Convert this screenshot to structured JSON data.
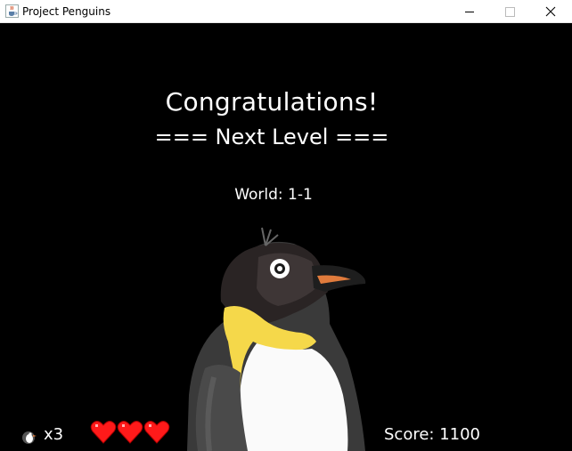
{
  "window": {
    "title": "Project Penguins",
    "icon": "java-cup-icon"
  },
  "game": {
    "message_line1": "Congratulations!",
    "message_line2": "=== Next Level ===",
    "world_label": "World: 1-1",
    "lives_text": "x3",
    "lives_count": 3,
    "hearts_shown": 3,
    "score_text": "Score: 1100",
    "colors": {
      "background": "#000000",
      "text": "#ffffff",
      "heart": "#ff1a1a",
      "penguin_beak_accent": "#e07b3c",
      "penguin_neck_yellow": "#f5d84a"
    }
  }
}
